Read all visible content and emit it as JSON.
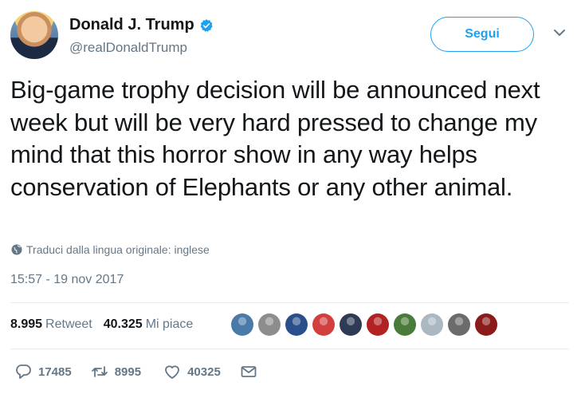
{
  "user": {
    "name": "Donald J. Trump",
    "handle": "@realDonaldTrump",
    "follow_label": "Segui"
  },
  "tweet": {
    "text": "Big-game trophy decision will be announced next week but will be very hard pressed to change my mind that this horror show in any way helps conservation of Elephants or any other animal.",
    "translate_label": "Traduci dalla lingua originale: inglese",
    "timestamp": "15:57 - 19 nov 2017"
  },
  "stats": {
    "retweets": "8.995",
    "retweets_label": "Retweet",
    "likes": "40.325",
    "likes_label": "Mi piace"
  },
  "likers": [
    {
      "icon": "liker-avatar",
      "color": "#4a7aa8"
    },
    {
      "icon": "liker-avatar",
      "color": "#8d8d8d"
    },
    {
      "icon": "liker-avatar",
      "color": "#2b4f8a"
    },
    {
      "icon": "liker-avatar",
      "color": "#d23f3f"
    },
    {
      "icon": "liker-avatar",
      "color": "#2f3b55"
    },
    {
      "icon": "liker-avatar",
      "color": "#b22222"
    },
    {
      "icon": "liker-avatar",
      "color": "#4b7b3a"
    },
    {
      "icon": "liker-avatar",
      "color": "#aab8c2"
    },
    {
      "icon": "liker-avatar",
      "color": "#6b6b6b"
    },
    {
      "icon": "liker-avatar",
      "color": "#8b1a1a"
    }
  ],
  "actions": {
    "replies": "17485",
    "retweets": "8995",
    "likes": "40325"
  },
  "colors": {
    "accent": "#1da1f2",
    "text": "#14171a",
    "secondary": "#657786",
    "divider": "#e6ecf0"
  }
}
